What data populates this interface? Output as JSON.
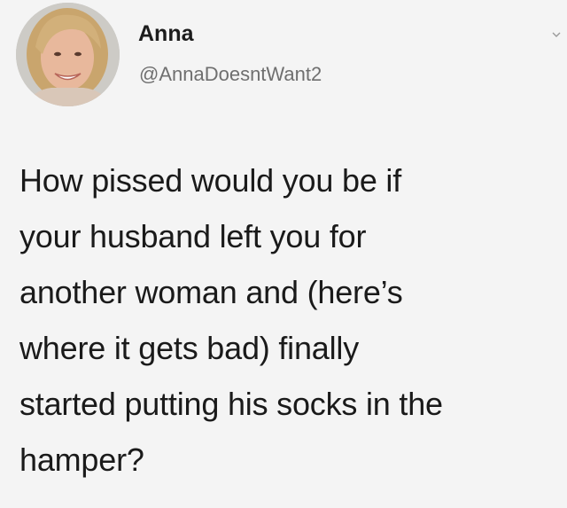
{
  "tweet": {
    "author": {
      "display_name": "Anna",
      "handle": "@AnnaDoesntWant2",
      "avatar_icon": "profile-photo"
    },
    "more_icon": "chevron-down-icon",
    "text_lines": [
      "How pissed would you be if",
      "your husband left you for",
      "another woman and (here’s",
      "where it gets bad) finally",
      "started putting his socks in the",
      "hamper?"
    ]
  },
  "colors": {
    "background": "#f4f4f4",
    "name": "#1c1c1c",
    "handle": "#6f6f6f",
    "text": "#1a1a1a"
  }
}
